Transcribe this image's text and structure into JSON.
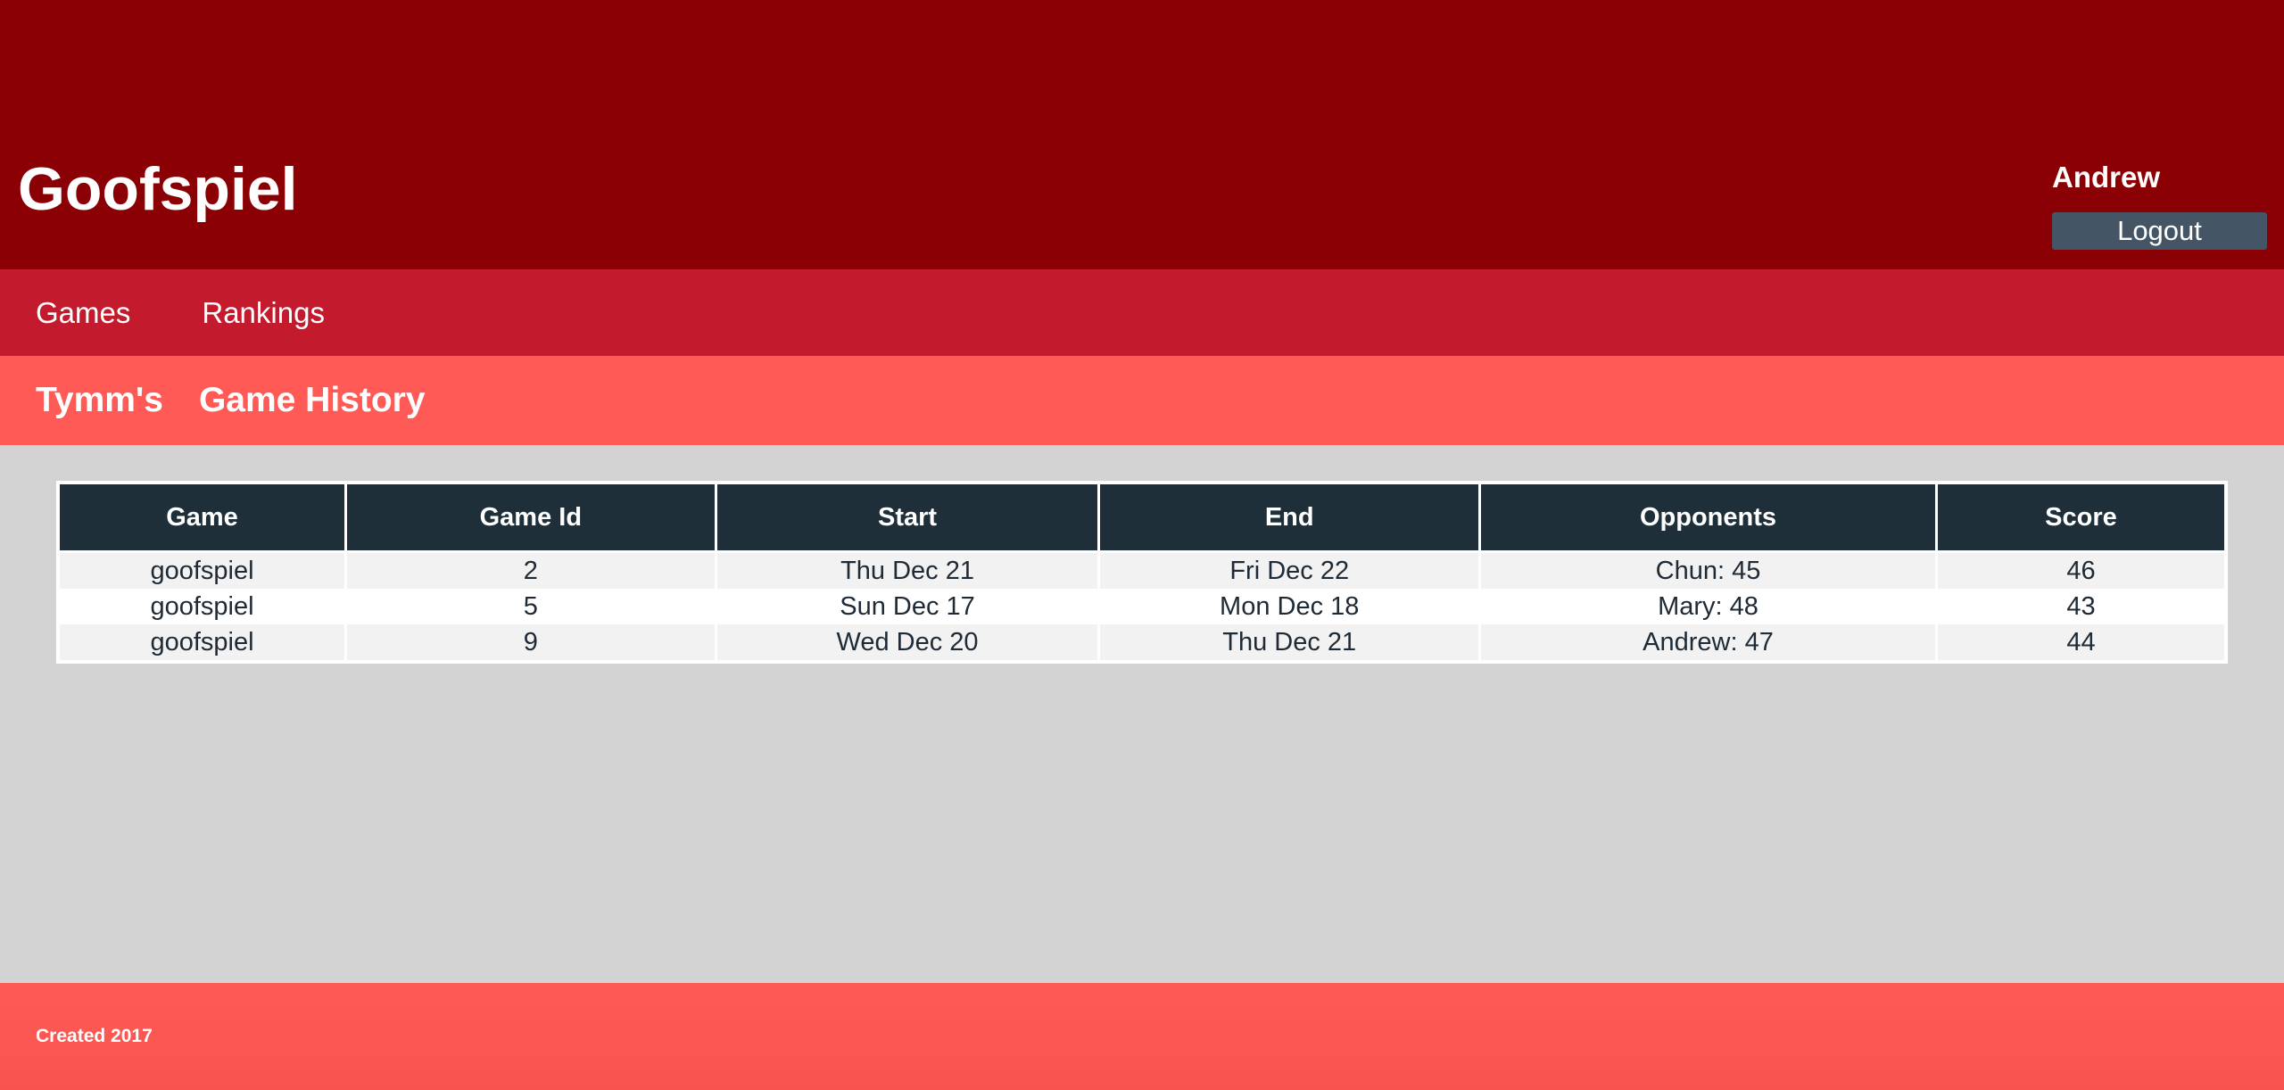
{
  "header": {
    "title": "Goofspiel",
    "username": "Andrew",
    "logout_label": "Logout"
  },
  "nav": {
    "items": [
      {
        "label": "Games"
      },
      {
        "label": "Rankings"
      }
    ]
  },
  "subheader": {
    "player": "Tymm's",
    "heading": "Game History"
  },
  "table": {
    "columns": [
      "Game",
      "Game Id",
      "Start",
      "End",
      "Opponents",
      "Score"
    ],
    "rows": [
      [
        "goofspiel",
        "2",
        "Thu Dec 21",
        "Fri Dec 22",
        "Chun: 45",
        "46"
      ],
      [
        "goofspiel",
        "5",
        "Sun Dec 17",
        "Mon Dec 18",
        "Mary: 48",
        "43"
      ],
      [
        "goofspiel",
        "9",
        "Wed Dec 20",
        "Thu Dec 21",
        "Andrew: 47",
        "44"
      ]
    ]
  },
  "footer": {
    "text": "Created 2017"
  },
  "colors": {
    "header_bg": "#8b0004",
    "nav_bg": "#c41a2d",
    "subheader_bg": "#ff5a55",
    "table_header_bg": "#1e2f3a",
    "logout_bg": "#445566",
    "page_bg": "#d3d3d3"
  }
}
